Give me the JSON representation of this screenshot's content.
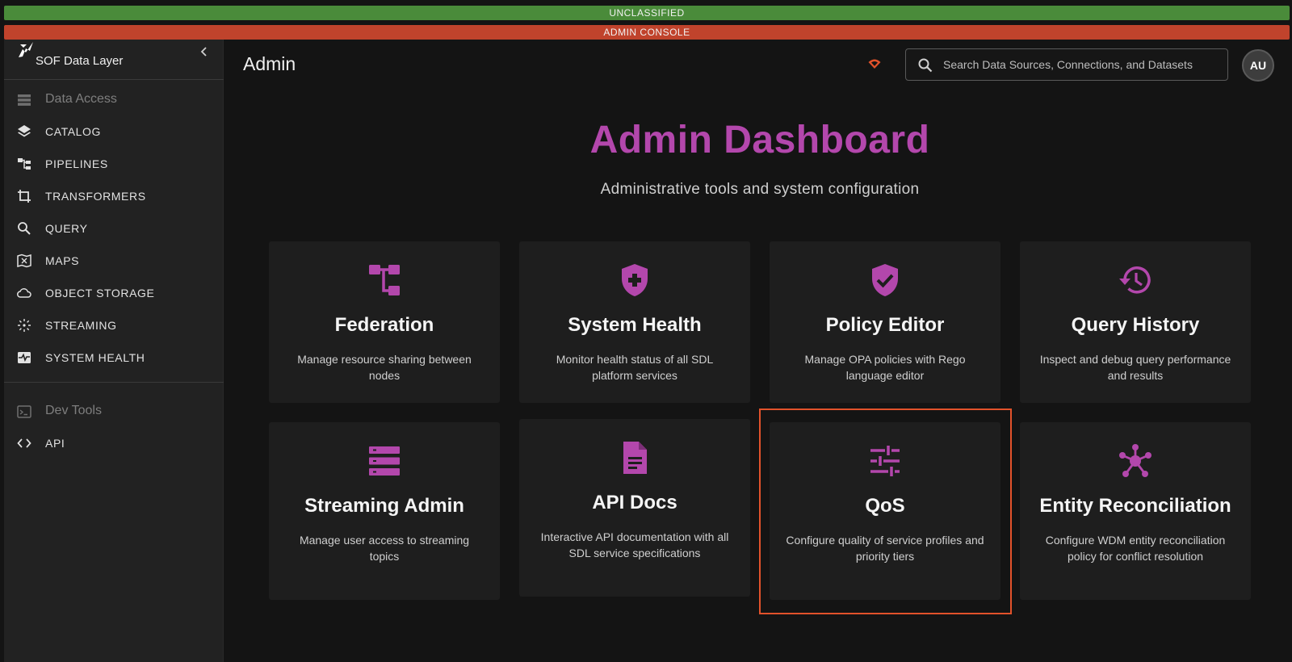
{
  "banners": {
    "classification": "UNCLASSIFIED",
    "console": "ADMIN CONSOLE"
  },
  "colors": {
    "accent": "#b347ac",
    "classification_banner": "#4a8b3a",
    "console_banner": "#c0432c",
    "highlight": "#e2522b"
  },
  "sidebar": {
    "brand": "SOF Data Layer",
    "collapse_icon": "chevron-left-icon",
    "sections": [
      {
        "label": "Data Access",
        "icon": "storage-icon"
      },
      {
        "label": "Dev Tools",
        "icon": "terminal-icon"
      }
    ],
    "items": [
      {
        "label": "CATALOG",
        "icon": "layers-icon"
      },
      {
        "label": "PIPELINES",
        "icon": "pipeline-icon"
      },
      {
        "label": "TRANSFORMERS",
        "icon": "crop-icon"
      },
      {
        "label": "QUERY",
        "icon": "search-icon"
      },
      {
        "label": "MAPS",
        "icon": "map-icon"
      },
      {
        "label": "OBJECT STORAGE",
        "icon": "cloud-icon"
      },
      {
        "label": "STREAMING",
        "icon": "streaming-icon"
      },
      {
        "label": "SYSTEM HEALTH",
        "icon": "monitor-heart-icon"
      },
      {
        "label": "API",
        "icon": "code-icon"
      }
    ]
  },
  "header": {
    "title": "Admin",
    "search_placeholder": "Search Data Sources, Connections, and Datasets",
    "avatar_initials": "AU"
  },
  "main": {
    "title": "Admin Dashboard",
    "subtitle": "Administrative tools and system configuration",
    "cards": [
      {
        "title": "Federation",
        "description": "Manage resource sharing between nodes",
        "icon": "federation-icon"
      },
      {
        "title": "System Health",
        "description": "Monitor health status of all SDL platform services",
        "icon": "health-shield-icon"
      },
      {
        "title": "Policy Editor",
        "description": "Manage OPA policies with Rego language editor",
        "icon": "verified-shield-icon"
      },
      {
        "title": "Query History",
        "description": "Inspect and debug query performance and results",
        "icon": "history-icon"
      },
      {
        "title": "Streaming Admin",
        "description": "Manage user access to streaming topics",
        "icon": "list-icon"
      },
      {
        "title": "API Docs",
        "description": "Interactive API documentation with all SDL service specifications",
        "icon": "document-icon"
      },
      {
        "title": "QoS",
        "description": "Configure quality of service profiles and priority tiers",
        "icon": "tune-icon"
      },
      {
        "title": "Entity Reconciliation",
        "description": "Configure WDM entity reconciliation policy for conflict resolution",
        "icon": "hub-icon"
      }
    ]
  }
}
